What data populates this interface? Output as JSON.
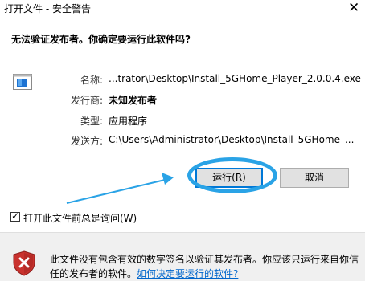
{
  "window": {
    "title": "打开文件 - 安全警告",
    "close_glyph": "✕"
  },
  "heading": "无法验证发布者。你确定要运行此软件吗?",
  "details": {
    "name_label": "名称:",
    "name_value": "...trator\\Desktop\\Install_5GHome_Player_2.0.0.4.exe",
    "publisher_label": "发行商:",
    "publisher_value": "未知发布者",
    "type_label": "类型:",
    "type_value": "应用程序",
    "from_label": "发送方:",
    "from_value": "C:\\Users\\Administrator\\Desktop\\Install_5GHome_..."
  },
  "buttons": {
    "run": "运行(R)",
    "cancel": "取消"
  },
  "checkbox": {
    "label": "打开此文件前总是询问(W)",
    "checked": true,
    "mark": "✓"
  },
  "footer": {
    "text": "此文件没有包含有效的数字签名以验证其发布者。你应该只运行来自你信任的发布者的软件。",
    "link": "如何决定要运行的软件?"
  },
  "icons": {
    "file": "application-file-icon",
    "warning": "security-shield-warning-icon"
  },
  "colors": {
    "annotation": "#2aa3e6",
    "link": "#0066cc",
    "default_button_border": "#0078d7",
    "shield_red": "#c9322e"
  }
}
